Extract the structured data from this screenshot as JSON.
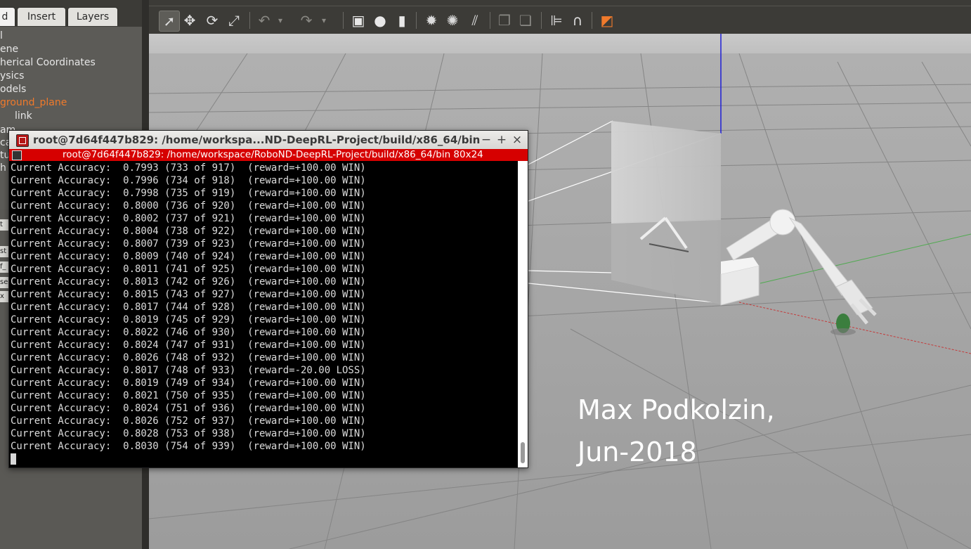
{
  "left_panel": {
    "tabs": [
      {
        "label": "d",
        "active": true
      },
      {
        "label": "Insert",
        "active": false
      },
      {
        "label": "Layers",
        "active": false
      }
    ],
    "tree": [
      {
        "label": "l",
        "selected": false
      },
      {
        "label": "ene",
        "selected": false
      },
      {
        "label": "herical Coordinates",
        "selected": false
      },
      {
        "label": "ysics",
        "selected": false
      },
      {
        "label": "odels",
        "selected": false
      },
      {
        "label": "ground_plane",
        "selected": true
      },
      {
        "label": "link",
        "selected": false
      },
      {
        "label": "am",
        "selected": false
      },
      {
        "label": "ca",
        "selected": false
      },
      {
        "label": "tu",
        "selected": false
      },
      {
        "label": "h",
        "selected": false
      }
    ],
    "side_buttons": [
      "t",
      "st",
      "f_",
      "se",
      "x"
    ]
  },
  "toolbar": {
    "buttons": [
      {
        "name": "select-mode",
        "icon": "cursor-arrow-icon",
        "glyph": "➚",
        "active": true
      },
      {
        "name": "translate-mode",
        "icon": "move-arrows-icon",
        "glyph": "✥",
        "active": false
      },
      {
        "name": "rotate-mode",
        "icon": "rotate-icon",
        "glyph": "⟳",
        "active": false
      },
      {
        "name": "scale-mode",
        "icon": "scale-icon",
        "glyph": "⤢",
        "active": false
      },
      {
        "name": "undo",
        "icon": "undo-icon",
        "glyph": "↶",
        "dim": true
      },
      {
        "name": "undo-history",
        "icon": "chevron-down-icon",
        "glyph": "▾",
        "dim": true
      },
      {
        "name": "redo",
        "icon": "redo-icon",
        "glyph": "↷",
        "dim": true
      },
      {
        "name": "redo-history",
        "icon": "chevron-down-icon",
        "glyph": "▾",
        "dim": true
      },
      {
        "name": "insert-box",
        "icon": "box-icon",
        "glyph": "▣"
      },
      {
        "name": "insert-sphere",
        "icon": "sphere-icon",
        "glyph": "●"
      },
      {
        "name": "insert-cylinder",
        "icon": "cylinder-icon",
        "glyph": "▮"
      },
      {
        "name": "point-light",
        "icon": "point-light-icon",
        "glyph": "✹"
      },
      {
        "name": "spot-light",
        "icon": "spot-light-icon",
        "glyph": "✺"
      },
      {
        "name": "directional-light",
        "icon": "directional-light-icon",
        "glyph": "⫽"
      },
      {
        "name": "copy",
        "icon": "copy-icon",
        "glyph": "❐",
        "dim": true
      },
      {
        "name": "paste",
        "icon": "paste-icon",
        "glyph": "❏",
        "dim": true
      },
      {
        "name": "align",
        "icon": "align-icon",
        "glyph": "⊫"
      },
      {
        "name": "snap",
        "icon": "magnet-icon",
        "glyph": "∩"
      },
      {
        "name": "view-angle",
        "icon": "view-cube-icon",
        "glyph": "◩"
      }
    ]
  },
  "terminal": {
    "title": "root@7d64f447b829: /home/workspa...ND-DeepRL-Project/build/x86_64/bin",
    "subtitle": "root@7d64f447b829: /home/workspace/RoboND-DeepRL-Project/build/x86_64/bin 80x24",
    "controls": {
      "minimize": "−",
      "maximize": "+",
      "close": "×"
    },
    "lines": [
      "Current Accuracy:  0.7993 (733 of 917)  (reward=+100.00 WIN)",
      "Current Accuracy:  0.7996 (734 of 918)  (reward=+100.00 WIN)",
      "Current Accuracy:  0.7998 (735 of 919)  (reward=+100.00 WIN)",
      "Current Accuracy:  0.8000 (736 of 920)  (reward=+100.00 WIN)",
      "Current Accuracy:  0.8002 (737 of 921)  (reward=+100.00 WIN)",
      "Current Accuracy:  0.8004 (738 of 922)  (reward=+100.00 WIN)",
      "Current Accuracy:  0.8007 (739 of 923)  (reward=+100.00 WIN)",
      "Current Accuracy:  0.8009 (740 of 924)  (reward=+100.00 WIN)",
      "Current Accuracy:  0.8011 (741 of 925)  (reward=+100.00 WIN)",
      "Current Accuracy:  0.8013 (742 of 926)  (reward=+100.00 WIN)",
      "Current Accuracy:  0.8015 (743 of 927)  (reward=+100.00 WIN)",
      "Current Accuracy:  0.8017 (744 of 928)  (reward=+100.00 WIN)",
      "Current Accuracy:  0.8019 (745 of 929)  (reward=+100.00 WIN)",
      "Current Accuracy:  0.8022 (746 of 930)  (reward=+100.00 WIN)",
      "Current Accuracy:  0.8024 (747 of 931)  (reward=+100.00 WIN)",
      "Current Accuracy:  0.8026 (748 of 932)  (reward=+100.00 WIN)",
      "Current Accuracy:  0.8017 (748 of 933)  (reward=-20.00 LOSS)",
      "Current Accuracy:  0.8019 (749 of 934)  (reward=+100.00 WIN)",
      "Current Accuracy:  0.8021 (750 of 935)  (reward=+100.00 WIN)",
      "Current Accuracy:  0.8024 (751 of 936)  (reward=+100.00 WIN)",
      "Current Accuracy:  0.8026 (752 of 937)  (reward=+100.00 WIN)",
      "Current Accuracy:  0.8028 (753 of 938)  (reward=+100.00 WIN)",
      "Current Accuracy:  0.8030 (754 of 939)  (reward=+100.00 WIN)"
    ]
  },
  "viewport": {
    "watermark_line1": "Max Podkolzin,",
    "watermark_line2": "Jun-2018"
  },
  "colors": {
    "accent_orange": "#f07a2b",
    "terminal_subbar_red": "#d60000",
    "ground_gray": "#a7a7a7"
  }
}
